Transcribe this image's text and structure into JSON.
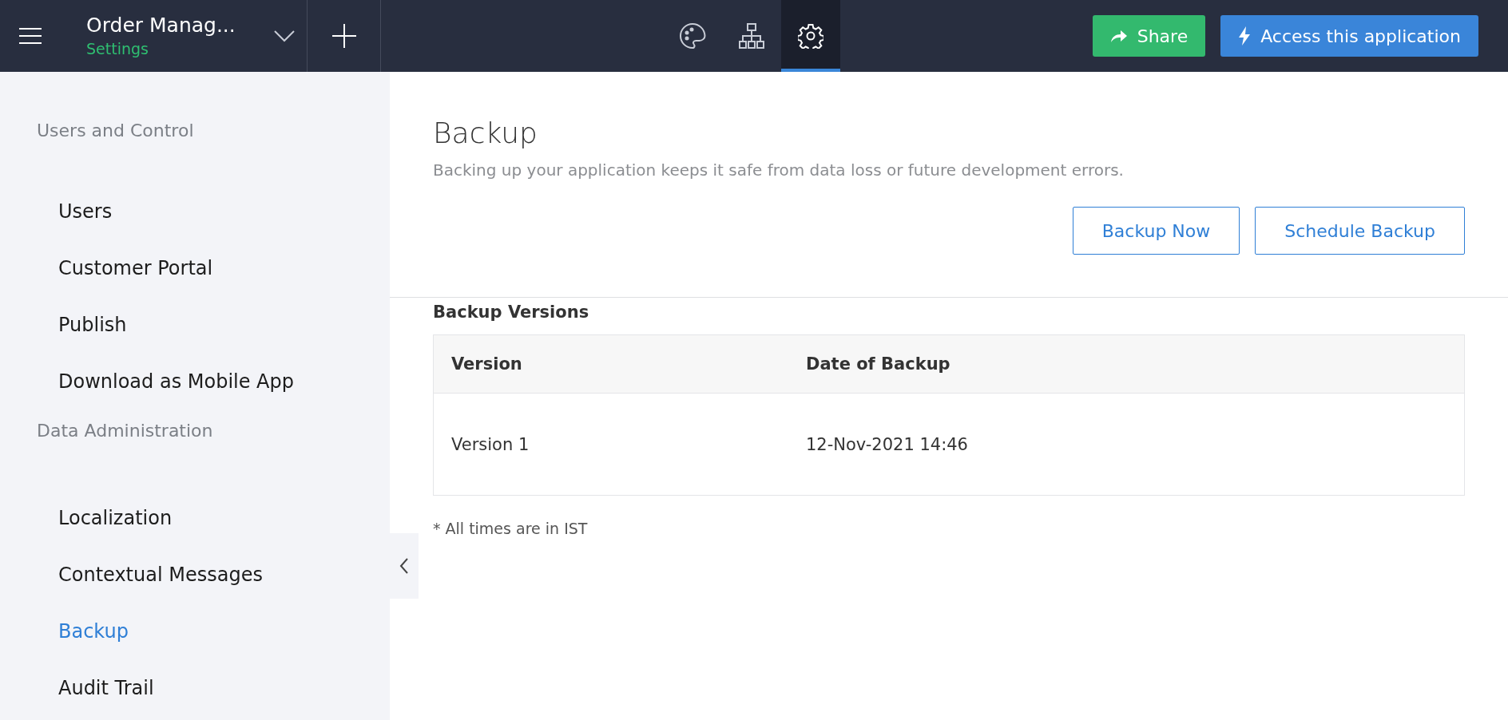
{
  "header": {
    "app_name": "Order Manag...",
    "app_subtitle": "Settings",
    "toolbar_icons": [
      {
        "kind": "palette",
        "selected": false
      },
      {
        "kind": "hierarchy",
        "selected": false
      },
      {
        "kind": "settings",
        "selected": true
      }
    ],
    "share_button": "Share",
    "access_button": "Access this application"
  },
  "sidebar": {
    "sections": [
      {
        "title": "Users and Control",
        "items": [
          {
            "label": "Users",
            "selected": false
          },
          {
            "label": "Customer Portal",
            "selected": false
          },
          {
            "label": "Publish",
            "selected": false
          },
          {
            "label": "Download as Mobile App",
            "selected": false
          }
        ]
      },
      {
        "title": "Data Administration",
        "items": [
          {
            "label": "Localization",
            "selected": false
          },
          {
            "label": "Contextual Messages",
            "selected": false
          },
          {
            "label": "Backup",
            "selected": true
          },
          {
            "label": "Audit Trail",
            "selected": false
          }
        ]
      }
    ]
  },
  "content": {
    "title": "Backup",
    "description": "Backing up your application keeps it safe from data loss or future development errors.",
    "buttons": [
      "Backup Now",
      "Schedule Backup"
    ],
    "versions_title": "Backup Versions",
    "table": {
      "columns": [
        "Version",
        "Date of Backup"
      ],
      "rows": [
        [
          "Version 1",
          "12-Nov-2021 14:46"
        ]
      ]
    },
    "footnote": "* All times are in IST"
  }
}
